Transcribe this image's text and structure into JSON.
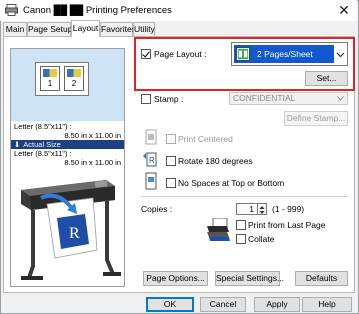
{
  "window": {
    "title": "Canon  ██ ██ Printing Preferences",
    "close_label": "✕"
  },
  "tabs": [
    {
      "label": "Main"
    },
    {
      "label": "Page Setup"
    },
    {
      "label": "Layout"
    },
    {
      "label": "Favorites"
    },
    {
      "label": "Utility"
    }
  ],
  "preview": {
    "page1": "1",
    "page2": "2",
    "paper_line1": "Letter (8.5\"x11\") :",
    "paper_line2": "8.50 in x 11.00 in",
    "actual_size": "Actual Size",
    "paper_line3": "Letter (8.5\"x11\") :",
    "paper_line4": "8.50 in x 11.00 in",
    "poster_letter": "R"
  },
  "page_layout": {
    "label": "Page Layout :",
    "checked": true,
    "selected": "2 Pages/Sheet",
    "set_button": "Set..."
  },
  "stamp": {
    "label": "Stamp :",
    "value": "CONFIDENTIAL",
    "define_button": "Define Stamp..."
  },
  "options": {
    "print_centered": "Print Centered",
    "rotate": "Rotate 180 degrees",
    "no_spaces": "No Spaces at Top or Bottom"
  },
  "copies": {
    "label": "Copies :",
    "value": "1",
    "range": "(1 - 999)",
    "print_from_last": "Print from Last Page",
    "collate": "Collate"
  },
  "buttons": {
    "page_options": "Page Options...",
    "special_settings": "Special Settings...",
    "defaults": "Defaults",
    "ok": "OK",
    "cancel": "Cancel",
    "apply": "Apply",
    "help": "Help"
  }
}
